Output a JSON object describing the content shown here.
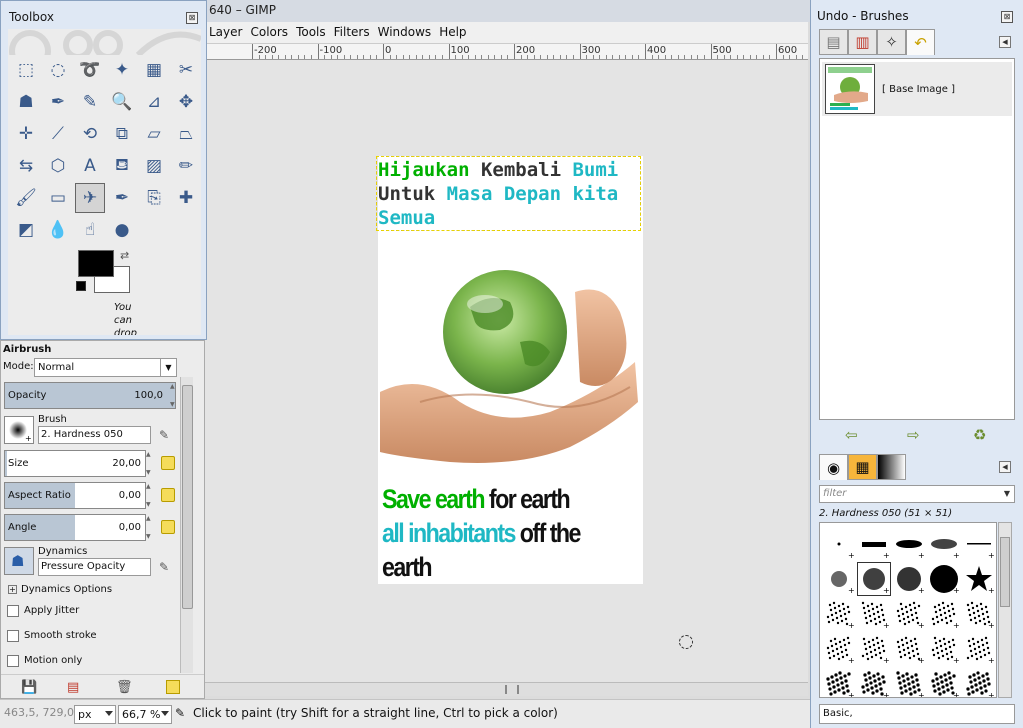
{
  "window": {
    "title_fragment": "640 – GIMP"
  },
  "menubar": {
    "items": [
      {
        "label": "Layer",
        "name": "menu-layer"
      },
      {
        "label": "Colors",
        "name": "menu-colors"
      },
      {
        "label": "Tools",
        "name": "menu-tools"
      },
      {
        "label": "Filters",
        "name": "menu-filters"
      },
      {
        "label": "Windows",
        "name": "menu-windows"
      },
      {
        "label": "Help",
        "name": "menu-help"
      }
    ]
  },
  "ruler": {
    "labels": [
      "-200",
      "-100",
      "0",
      "100",
      "200",
      "300",
      "400",
      "500",
      "600"
    ]
  },
  "canvas": {
    "text_layer": {
      "line1": [
        {
          "text": "Hijaukan",
          "color": "#00b000"
        },
        {
          "text": " Kembali",
          "color": "#333333"
        },
        {
          "text": " Bumi",
          "color": "#1fb8c4"
        }
      ],
      "line2": [
        {
          "text": "Untuk",
          "color": "#333333"
        },
        {
          "text": " Masa Depan kita",
          "color": "#1fb8c4"
        }
      ],
      "line3": [
        {
          "text": "Semua",
          "color": "#1fb8c4"
        }
      ]
    },
    "slogan": {
      "line1": [
        {
          "text": "Save earth",
          "color": "#00b000"
        },
        {
          "text": " for earth",
          "color": "#111111"
        }
      ],
      "line2": [
        {
          "text": "all inhabitants",
          "color": "#1fb8c4"
        },
        {
          "text": " off the",
          "color": "#111111"
        }
      ],
      "line3": [
        {
          "text": "earth",
          "color": "#111111"
        }
      ]
    }
  },
  "statusbar": {
    "coords": "463,5, 729,0",
    "unit": "px",
    "zoom": "66,7 %",
    "message": "Click to paint (try Shift for a straight line, Ctrl to pick a color)"
  },
  "toolbox": {
    "title": "Toolbox",
    "close_glyph": "⊠",
    "tools": [
      {
        "name": "rect-select-tool",
        "glyph": "⬚"
      },
      {
        "name": "ellipse-select-tool",
        "glyph": "◌"
      },
      {
        "name": "free-select-tool",
        "glyph": "➰"
      },
      {
        "name": "fuzzy-select-tool",
        "glyph": "✦"
      },
      {
        "name": "color-select-tool",
        "glyph": "▦"
      },
      {
        "name": "scissors-tool",
        "glyph": "✂"
      },
      {
        "name": "foreground-select-tool",
        "glyph": "☗"
      },
      {
        "name": "paths-tool",
        "glyph": "✒"
      },
      {
        "name": "color-picker-tool",
        "glyph": "✎"
      },
      {
        "name": "zoom-tool",
        "glyph": "🔍"
      },
      {
        "name": "measure-tool",
        "glyph": "⊿"
      },
      {
        "name": "move-tool",
        "glyph": "✥"
      },
      {
        "name": "align-tool",
        "glyph": "✛"
      },
      {
        "name": "crop-tool",
        "glyph": "⟋"
      },
      {
        "name": "rotate-tool",
        "glyph": "⟲"
      },
      {
        "name": "scale-tool",
        "glyph": "⧉"
      },
      {
        "name": "shear-tool",
        "glyph": "▱"
      },
      {
        "name": "perspective-tool",
        "glyph": "⏢"
      },
      {
        "name": "flip-tool",
        "glyph": "⇆"
      },
      {
        "name": "cage-tool",
        "glyph": "⬡"
      },
      {
        "name": "text-tool",
        "glyph": "A"
      },
      {
        "name": "bucket-fill-tool",
        "glyph": "⛾"
      },
      {
        "name": "blend-tool",
        "glyph": "▨"
      },
      {
        "name": "pencil-tool",
        "glyph": "✏"
      },
      {
        "name": "paintbrush-tool",
        "glyph": "🖌"
      },
      {
        "name": "eraser-tool",
        "glyph": "▭"
      },
      {
        "name": "airbrush-tool",
        "glyph": "✈"
      },
      {
        "name": "ink-tool",
        "glyph": "✒"
      },
      {
        "name": "clone-tool",
        "glyph": "⎘"
      },
      {
        "name": "heal-tool",
        "glyph": "✚"
      },
      {
        "name": "perspective-clone-tool",
        "glyph": "◩"
      },
      {
        "name": "blur-tool",
        "glyph": "💧"
      },
      {
        "name": "smudge-tool",
        "glyph": "☝"
      },
      {
        "name": "dodge-burn-tool",
        "glyph": "●"
      }
    ],
    "active_tool": 26,
    "drop_hint": "You can drop"
  },
  "tool_options": {
    "title": "Airbrush",
    "mode_label": "Mode:",
    "mode_value": "Normal",
    "opacity": {
      "label": "Opacity",
      "value": "100,0",
      "fraction": 1.0
    },
    "brush_label": "Brush",
    "brush_value": "2. Hardness 050",
    "size": {
      "label": "Size",
      "value": "20,00",
      "fraction": 0.02
    },
    "aspect": {
      "label": "Aspect Ratio",
      "value": "0,00",
      "fraction": 0.5
    },
    "angle": {
      "label": "Angle",
      "value": "0,00",
      "fraction": 0.5
    },
    "dynamics_label": "Dynamics",
    "dynamics_value": "Pressure Opacity",
    "dynamics_options": "Dynamics Options",
    "checks": [
      {
        "label": "Apply Jitter",
        "name": "apply-jitter-checkbox"
      },
      {
        "label": "Smooth stroke",
        "name": "smooth-stroke-checkbox"
      },
      {
        "label": "Motion only",
        "name": "motion-only-checkbox"
      }
    ]
  },
  "right_dock": {
    "title": "Undo - Brushes",
    "undo_item": "[ Base Image ]",
    "brush_filter_placeholder": "filter",
    "brush_selected": "2. Hardness 050 (51 × 51)",
    "preset": "Basic,"
  }
}
